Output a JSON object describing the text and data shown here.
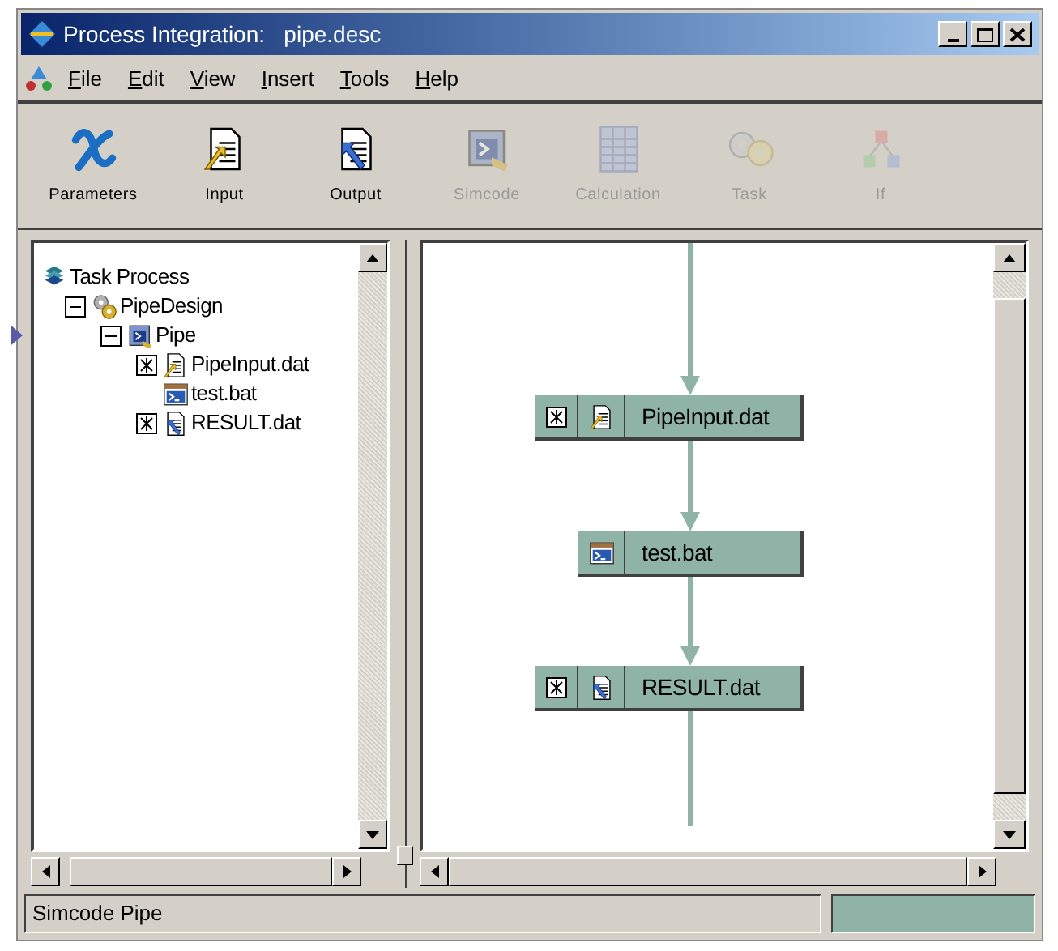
{
  "window": {
    "title": "Process Integration:   pipe.desc"
  },
  "menu": [
    "File",
    "Edit",
    "View",
    "Insert",
    "Tools",
    "Help"
  ],
  "toolbar": [
    {
      "label": "Parameters",
      "kind": "parameters",
      "disabled": false
    },
    {
      "label": "Input",
      "kind": "input",
      "disabled": false
    },
    {
      "label": "Output",
      "kind": "output",
      "disabled": false
    },
    {
      "label": "Simcode",
      "kind": "simcode",
      "disabled": true
    },
    {
      "label": "Calculation",
      "kind": "calculation",
      "disabled": true
    },
    {
      "label": "Task",
      "kind": "task",
      "disabled": true
    },
    {
      "label": "If",
      "kind": "if",
      "disabled": true
    }
  ],
  "tree": [
    {
      "label": "Task Process",
      "kind": "task",
      "current": false,
      "children": [
        {
          "label": "PipeDesign",
          "kind": "design",
          "expanded": true,
          "current": false,
          "children": [
            {
              "label": "Pipe",
              "kind": "simcode",
              "expanded": true,
              "current": true,
              "children": [
                {
                  "label": "PipeInput.dat",
                  "kind": "input",
                  "expandable": true,
                  "current": false
                },
                {
                  "label": "test.bat",
                  "kind": "script",
                  "expandable": false,
                  "current": false
                },
                {
                  "label": "RESULT.dat",
                  "kind": "output",
                  "expandable": true,
                  "current": false
                }
              ]
            }
          ]
        }
      ]
    }
  ],
  "flow": [
    {
      "label": "PipeInput.dat",
      "kind": "input",
      "expandable": true
    },
    {
      "label": "test.bat",
      "kind": "script",
      "expandable": false
    },
    {
      "label": "RESULT.dat",
      "kind": "output",
      "expandable": true
    }
  ],
  "status_bar": {
    "text": "Simcode Pipe"
  }
}
